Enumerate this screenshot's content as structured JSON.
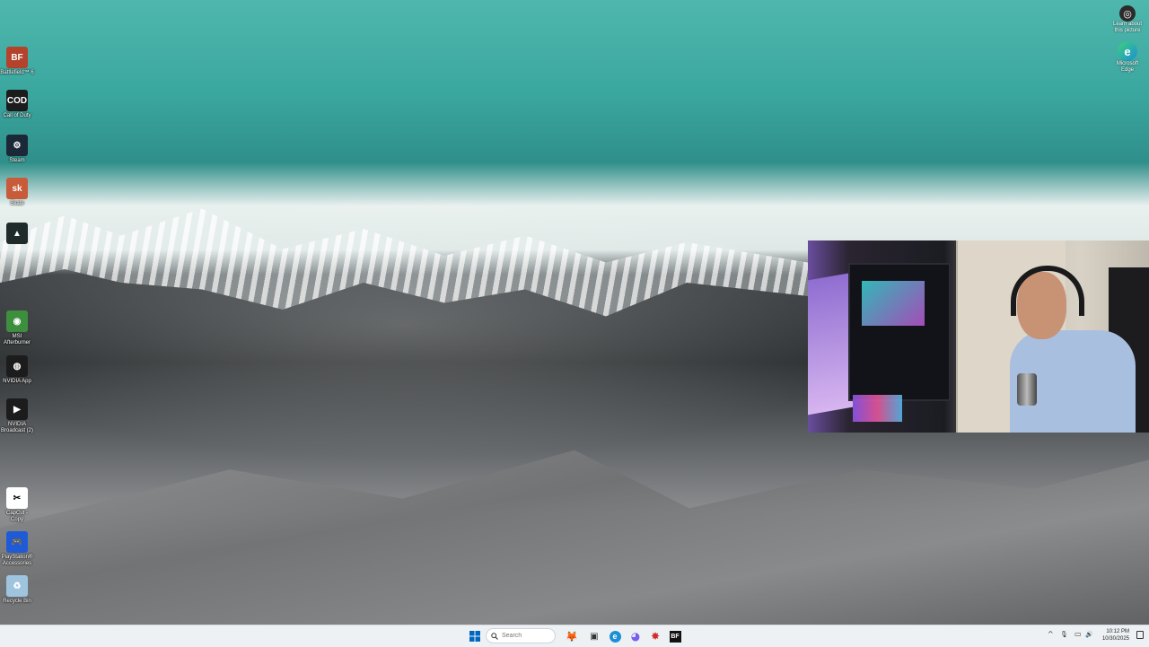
{
  "desktop": {
    "left_icons": [
      {
        "label": "Battlefield™ 6",
        "icon": "battlefield-icon",
        "color": "#b3432a",
        "glyph": "BF"
      },
      {
        "label": "Call of Duty",
        "icon": "call-of-duty-icon",
        "color": "#1c1c1c",
        "glyph": "COD"
      },
      {
        "label": "Steam",
        "icon": "steam-icon",
        "color": "#1b2838",
        "glyph": "⚙"
      },
      {
        "label": "Skate",
        "icon": "skate-icon",
        "color": "#c75b3a",
        "glyph": "sk"
      },
      {
        "label": "",
        "icon": "alienware-command-icon",
        "color": "#1f2a2a",
        "glyph": "▲"
      },
      {
        "label": "MSI Afterburner",
        "icon": "msi-afterburner-icon",
        "color": "#3d8f3d",
        "glyph": "◉"
      },
      {
        "label": "NVIDIA App",
        "icon": "nvidia-app-icon",
        "color": "#1c1c1c",
        "glyph": "◍"
      },
      {
        "label": "NVIDIA Broadcast (2)",
        "icon": "nvidia-broadcast-icon",
        "color": "#1c1c1c",
        "glyph": "▶"
      },
      {
        "label": "CapCut - Copy",
        "icon": "capcut-icon",
        "color": "#ffffff",
        "glyph": "✂"
      },
      {
        "label": "PlayStation® Accessories",
        "icon": "playstation-accessories-icon",
        "color": "#1f5bd6",
        "glyph": "🎮"
      },
      {
        "label": "Recycle Bin",
        "icon": "recycle-bin-icon",
        "color": "#9fc4de",
        "glyph": "♻"
      }
    ],
    "right_icons": [
      {
        "label": "Learn about this picture",
        "icon": "learn-about-picture-icon",
        "glyph": "◎"
      },
      {
        "label": "Microsoft Edge",
        "icon": "microsoft-edge-icon",
        "glyph": "e"
      }
    ]
  },
  "taskbar": {
    "search_placeholder": "Search",
    "pinned": [
      {
        "icon": "start-icon",
        "glyph": "⊞",
        "color": "#0067c0"
      },
      {
        "icon": "widgets-icon",
        "glyph": "🦊",
        "color": "#e07020"
      },
      {
        "icon": "file-explorer-icon",
        "glyph": "▣",
        "color": "#333333"
      },
      {
        "icon": "edge-icon",
        "glyph": "e",
        "color": "#1a8fd6"
      },
      {
        "icon": "discord-icon",
        "glyph": "◕",
        "color": "#7a5cf0"
      },
      {
        "icon": "game-app-icon",
        "glyph": "✸",
        "color": "#d42a2a"
      },
      {
        "icon": "battlefield-taskbar-icon",
        "glyph": "BF",
        "color": "#111111"
      }
    ],
    "tray": {
      "chevron": "^",
      "mic": "🎙",
      "network": "▭",
      "volume": "🔊"
    },
    "clock_time": "10:12 PM",
    "clock_date": "10/30/2025"
  }
}
